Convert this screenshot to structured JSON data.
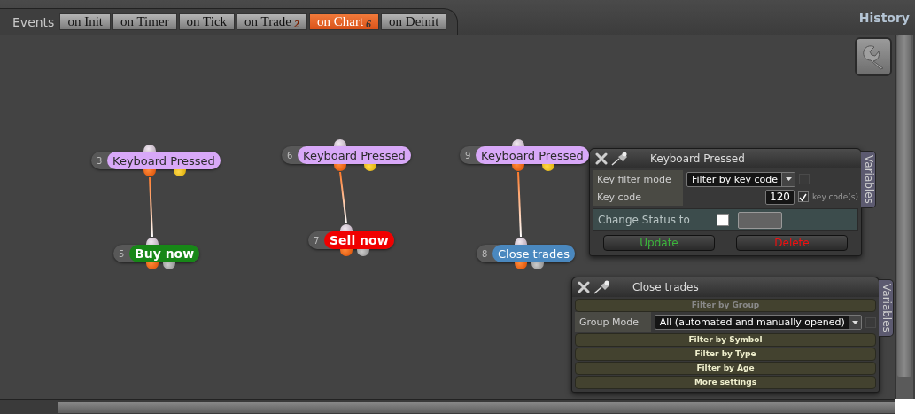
{
  "events_label": "Events",
  "tabs": [
    {
      "label": "on Init",
      "selected": false
    },
    {
      "label": "on Timer",
      "selected": false
    },
    {
      "label": "on Tick",
      "selected": false
    },
    {
      "label": "on Trade",
      "badge": "2",
      "selected": false
    },
    {
      "label": "on Chart",
      "badge": "6",
      "selected": true
    },
    {
      "label": "on Deinit",
      "selected": false
    }
  ],
  "history": "History",
  "nodes": [
    {
      "number": "3",
      "label": "Keyboard Pressed",
      "color": "#d8a8f8",
      "children": [
        {
          "number": "5",
          "label": "Buy now",
          "color": "#178717"
        }
      ]
    },
    {
      "number": "6",
      "label": "Keyboard Pressed",
      "color": "#d8a8f8",
      "children": [
        {
          "number": "7",
          "label": "Sell now",
          "color": "#f00000"
        }
      ]
    },
    {
      "number": "9",
      "label": "Keyboard Pressed",
      "color": "#d8a8f8",
      "children": [
        {
          "number": "8",
          "label": "Close trades",
          "color": "#4a88bf"
        }
      ]
    }
  ],
  "panels": [
    {
      "title": "Keyboard Pressed",
      "side_tab": "Variables",
      "fields": [
        {
          "kind": "select",
          "label": "Key filter mode",
          "value": "Filter by key code",
          "toggle": {
            "checked": false
          }
        },
        {
          "kind": "number",
          "label": "Key code",
          "value": "120",
          "toggle": {
            "checked": true,
            "label": "key code(s)"
          }
        }
      ],
      "status": {
        "label": "Change Status to",
        "checked": false
      },
      "buttons": [
        {
          "kind": "update",
          "label": "Update"
        },
        {
          "kind": "delete",
          "label": "Delete"
        }
      ]
    },
    {
      "title": "Close trades",
      "side_tab": "Variables",
      "sections": [
        {
          "label": "Filter by Group",
          "expanded": true,
          "fields": [
            {
              "kind": "select",
              "label": "Group Mode",
              "value": "All (automated and manually opened)",
              "toggle": {
                "checked": false
              }
            }
          ]
        },
        {
          "label": "Filter by Symbol",
          "expanded": false
        },
        {
          "label": "Filter by Type",
          "expanded": false
        },
        {
          "label": "Filter by Age",
          "expanded": false
        },
        {
          "label": "More settings",
          "expanded": false
        }
      ]
    }
  ]
}
